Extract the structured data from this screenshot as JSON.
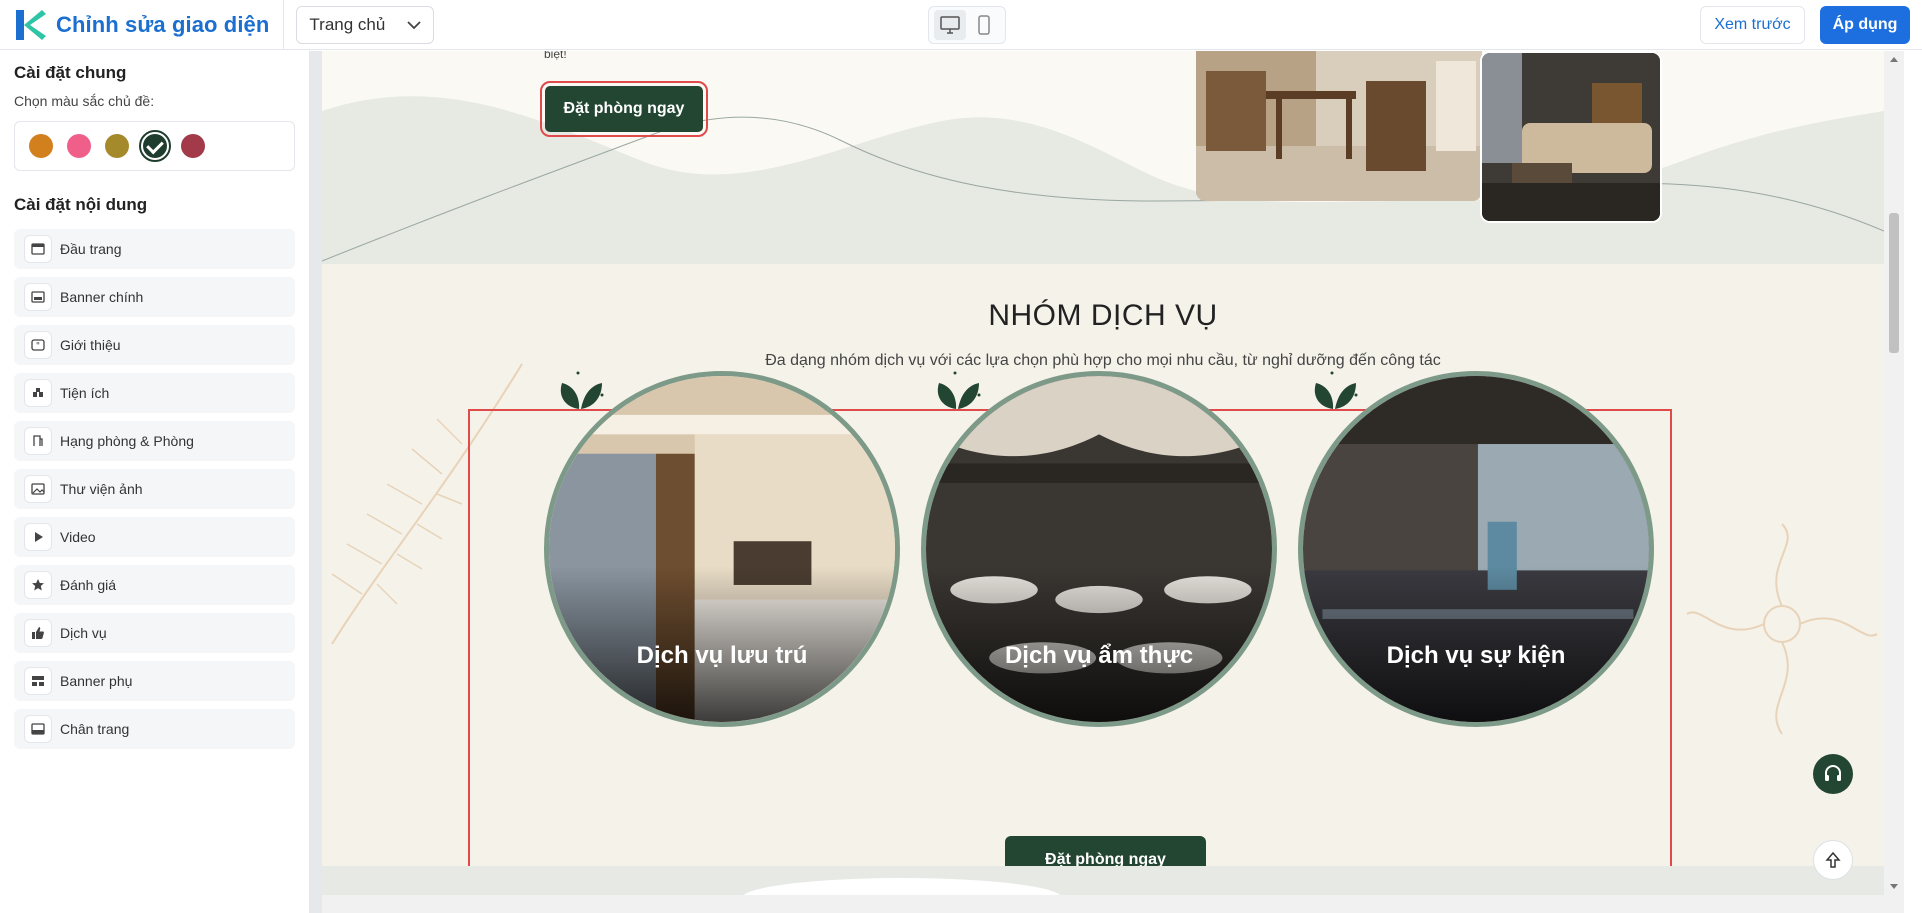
{
  "app": {
    "title": "Chỉnh sửa giao diện",
    "page_select": {
      "value": "Trang chủ"
    },
    "preview_label": "Xem trước",
    "apply_label": "Áp dụng"
  },
  "sidebar": {
    "general_title": "Cài đặt chung",
    "color_label": "Chọn màu sắc chủ đề:",
    "colors": [
      "#d27f1e",
      "#ef5f8a",
      "#a48a2a",
      "#1f3d2e",
      "#a23a4a"
    ],
    "selected_color": "#1f3d2e",
    "content_title": "Cài đặt nội dung",
    "items": [
      {
        "label": "Đầu trang",
        "icon": "header-icon"
      },
      {
        "label": "Banner chính",
        "icon": "banner-icon"
      },
      {
        "label": "Giới thiệu",
        "icon": "quote-icon"
      },
      {
        "label": "Tiện ích",
        "icon": "amenities-icon"
      },
      {
        "label": "Hạng phòng & Phòng",
        "icon": "room-icon"
      },
      {
        "label": "Thư viện ảnh",
        "icon": "image-icon"
      },
      {
        "label": "Video",
        "icon": "play-icon"
      },
      {
        "label": "Đánh giá",
        "icon": "star-icon"
      },
      {
        "label": "Dịch vụ",
        "icon": "thumbs-up-icon"
      },
      {
        "label": "Banner phụ",
        "icon": "sub-banner-icon"
      },
      {
        "label": "Chân trang",
        "icon": "footer-icon"
      }
    ]
  },
  "preview": {
    "hero_note": "biệt!",
    "hero_button": "Đặt phòng ngay",
    "services": {
      "title": "NHÓM DỊCH VỤ",
      "subtitle": "Đa dạng nhóm dịch vụ với các lựa chọn phù hợp cho mọi nhu cầu, từ nghỉ dưỡng đến công tác",
      "items": [
        {
          "label": "Dịch vụ lưu trú"
        },
        {
          "label": "Dịch vụ ẩm thực"
        },
        {
          "label": "Dịch vụ sự kiện"
        }
      ],
      "button": "Đặt phòng ngay"
    }
  }
}
